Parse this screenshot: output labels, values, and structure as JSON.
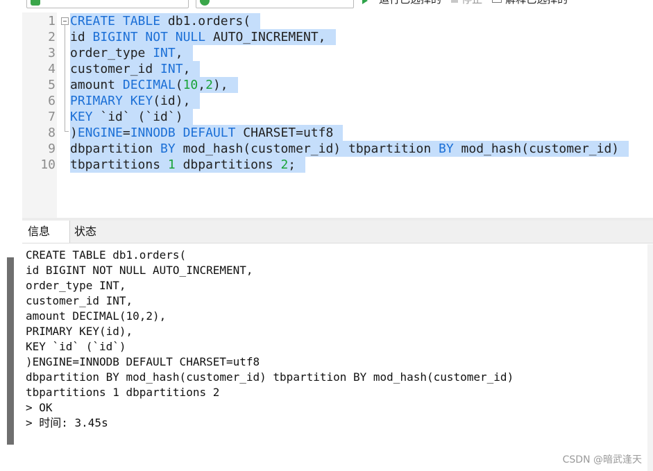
{
  "toolbar": {
    "run_selected_label": "运行已选择的",
    "stop_label": "停止",
    "explain_label": "解释已选择的"
  },
  "editor": {
    "line_numbers": [
      "1",
      "2",
      "3",
      "4",
      "5",
      "6",
      "7",
      "8",
      "9",
      "10"
    ]
  },
  "tabs": [
    {
      "label": "信息"
    },
    {
      "label": "状态"
    }
  ],
  "output": {
    "lines": [
      "CREATE TABLE db1.orders(",
      "id BIGINT NOT NULL AUTO_INCREMENT,",
      "order_type INT,",
      "customer_id INT,",
      "amount DECIMAL(10,2),",
      "PRIMARY KEY(id),",
      "KEY `id` (`id`)",
      ")ENGINE=INNODB DEFAULT CHARSET=utf8",
      "dbpartition BY mod_hash(customer_id) tbpartition BY mod_hash(customer_id)",
      "tbpartitions 1 dbpartitions 2",
      "> OK",
      "> 时间: 3.45s"
    ]
  },
  "watermark": "CSDN @暗武逢天"
}
